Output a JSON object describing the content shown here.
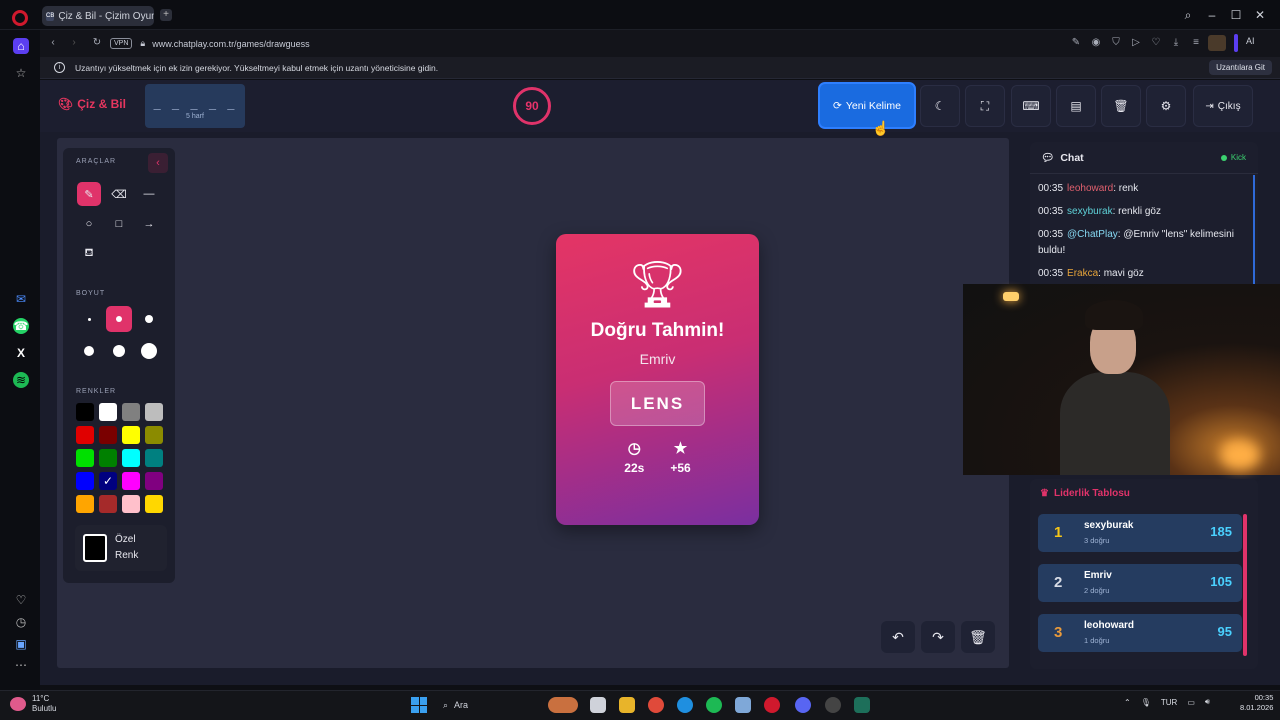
{
  "browser": {
    "tab_title": "Çiz & Bil - Çizim Oyun",
    "tab_favicon": "CB",
    "vpn_badge": "VPN",
    "url": "www.chatplay.com.tr/games/drawguess",
    "ai_label": "AI",
    "infobar_message": "Uzantıyı yükseltmek için ek izin gerekiyor. Yükseltmeyi kabul etmek için uzantı yöneticisine gidin.",
    "infobar_button": "Uzantılara Git"
  },
  "app": {
    "logo_text": "Çiz & Bil",
    "word_mask": "_ _ _ _ _",
    "word_length": "5 harf",
    "timer": "90",
    "new_word_label": "Yeni Kelime",
    "exit_label": "Çıkış",
    "accent_color": "#e0336a"
  },
  "tools": {
    "tools_title": "ARAÇLAR",
    "size_title": "BOYUT",
    "colors_title": "RENKLER",
    "custom_color_line1": "Özel",
    "custom_color_line2": "Renk",
    "colors": [
      "#000000",
      "#ffffff",
      "#808080",
      "#bdbdbd",
      "#e00000",
      "#7a0000",
      "#ffff00",
      "#8b8b00",
      "#00e000",
      "#008000",
      "#00ffff",
      "#008080",
      "#0000ff",
      "#000080",
      "#ff00ff",
      "#800080",
      "#ffa500",
      "#a52a2a",
      "#ffc0cb",
      "#ffd700"
    ]
  },
  "result": {
    "title": "Doğru Tahmin!",
    "guesser": "Emriv",
    "word": "LENS",
    "time": "22s",
    "points": "+56"
  },
  "chat": {
    "title": "Chat",
    "platform": "Kick",
    "messages": [
      {
        "time": "00:35",
        "user": "leohoward",
        "user_color": "#e0606e",
        "text": ": renk"
      },
      {
        "time": "00:35",
        "user": "sexyburak",
        "user_color": "#5fd3d9",
        "text": ": renkli göz"
      },
      {
        "time": "00:35",
        "user": "@ChatPlay",
        "user_color": "#86d8f2",
        "text": ": @Emriv \"lens\" kelimesini buldu!"
      },
      {
        "time": "00:35",
        "user": "Erakca",
        "user_color": "#e6a43a",
        "text": ": mavi göz"
      }
    ]
  },
  "leaderboard": {
    "title": "Liderlik Tablosu",
    "rows": [
      {
        "rank": "1",
        "name": "sexyburak",
        "sub": "3 doğru",
        "score": "185",
        "rank_color": "#f5c518"
      },
      {
        "rank": "2",
        "name": "Emriv",
        "sub": "2 doğru",
        "score": "105",
        "rank_color": "#d8dce6"
      },
      {
        "rank": "3",
        "name": "leohoward",
        "sub": "1 doğru",
        "score": "95",
        "rank_color": "#e89a3c"
      }
    ]
  },
  "taskbar": {
    "temperature": "11°C",
    "weather": "Bulutlu",
    "search": "Ara",
    "language": "TUR",
    "time": "00:35",
    "date": "8.01.2026"
  }
}
